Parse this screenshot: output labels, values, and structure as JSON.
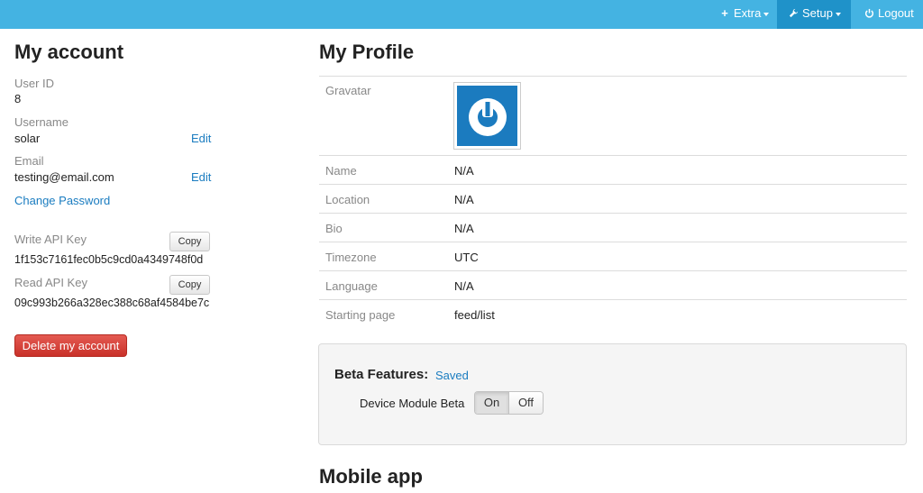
{
  "navbar": {
    "extra": {
      "icon": "plus-icon",
      "label": "Extra"
    },
    "setup": {
      "icon": "wrench-icon",
      "label": "Setup"
    },
    "logout": {
      "icon": "power-icon",
      "label": "Logout"
    }
  },
  "account": {
    "title": "My account",
    "user_id_label": "User ID",
    "user_id": "8",
    "username_label": "Username",
    "username": "solar",
    "username_edit": "Edit",
    "email_label": "Email",
    "email": "testing@email.com",
    "email_edit": "Edit",
    "change_password": "Change Password",
    "write_key_label": "Write API Key",
    "write_key": "1f153c7161fec0b5c9cd0a4349748f0d",
    "read_key_label": "Read API Key",
    "read_key": "09c993b266a328ec388c68af4584be7c",
    "copy_label": "Copy",
    "delete_label": "Delete my account"
  },
  "profile": {
    "title": "My Profile",
    "gravatar_label": "Gravatar",
    "rows": [
      {
        "label": "Name",
        "value": "N/A"
      },
      {
        "label": "Location",
        "value": "N/A"
      },
      {
        "label": "Bio",
        "value": "N/A"
      },
      {
        "label": "Timezone",
        "value": "UTC"
      },
      {
        "label": "Language",
        "value": "N/A"
      },
      {
        "label": "Starting page",
        "value": "feed/list"
      }
    ]
  },
  "beta": {
    "title": "Beta Features:",
    "status": "Saved",
    "device_label": "Device Module Beta",
    "on": "On",
    "off": "Off"
  },
  "mobile": {
    "title": "Mobile app"
  },
  "colors": {
    "navbar": "#44b3e2",
    "navbar_active": "#1f92c9",
    "link": "#1a7cc0",
    "danger": "#d9534f"
  }
}
